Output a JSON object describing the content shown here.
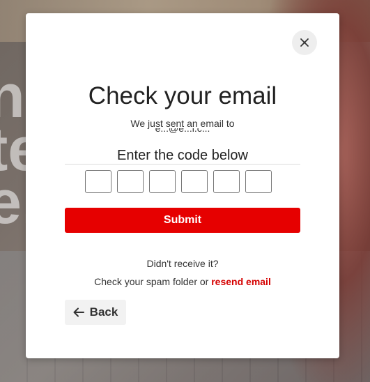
{
  "background": {
    "text_lines": [
      "n",
      "te",
      "e."
    ]
  },
  "modal": {
    "close_icon": "close-icon",
    "title": "Check your email",
    "sent_text": "We just sent an email to",
    "email_partial": "e...@e...l.c...",
    "code_label": "Enter the code below",
    "code_inputs": [
      "",
      "",
      "",
      "",
      "",
      ""
    ],
    "submit_label": "Submit",
    "didnt_receive": "Didn't receive it?",
    "spam_text": "Check your spam folder or ",
    "resend_label": "resend email",
    "back_icon": "arrow-left-icon",
    "back_label": "Back"
  },
  "colors": {
    "accent": "#e60000",
    "link": "#d50000"
  }
}
